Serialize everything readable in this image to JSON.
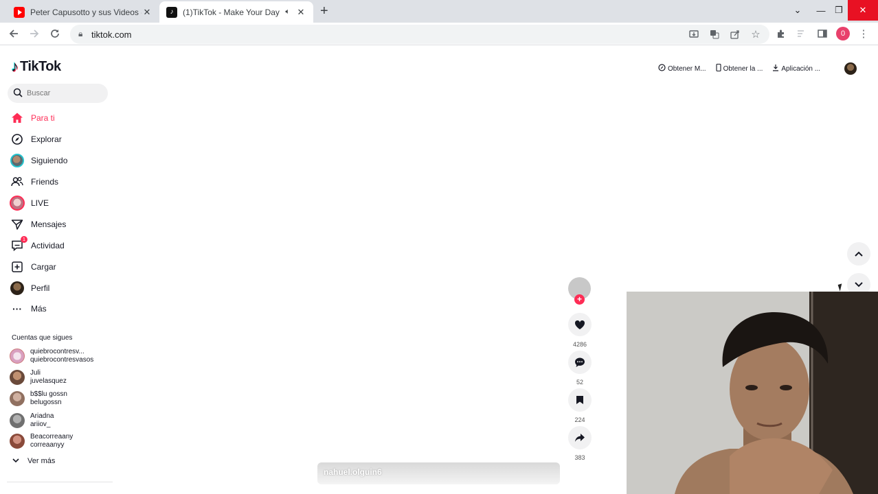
{
  "browser": {
    "tabs": [
      {
        "title": "Peter Capusotto y sus Videos - Yo",
        "active": false
      },
      {
        "title": "(1)TikTok - Make Your Day",
        "active": true
      }
    ],
    "url": "tiktok.com",
    "profile_initial": "0"
  },
  "tiktok": {
    "logo_text": "TikTok",
    "search_placeholder": "Buscar",
    "nav": [
      {
        "label": "Para ti",
        "icon": "home-icon",
        "active": true
      },
      {
        "label": "Explorar",
        "icon": "compass-icon"
      },
      {
        "label": "Siguiendo",
        "icon": "avatar"
      },
      {
        "label": "Friends",
        "icon": "friends-icon"
      },
      {
        "label": "LIVE",
        "icon": "avatar"
      },
      {
        "label": "Mensajes",
        "icon": "send-icon"
      },
      {
        "label": "Actividad",
        "icon": "inbox-icon",
        "badge": "1"
      },
      {
        "label": "Cargar",
        "icon": "upload-icon"
      },
      {
        "label": "Perfil",
        "icon": "avatar"
      },
      {
        "label": "Más",
        "icon": "more-icon"
      }
    ],
    "following_title": "Cuentas que sigues",
    "following": [
      {
        "name": "quiebrocontresv...",
        "handle": "quiebrocontresvasos",
        "color": "#d9a0c0"
      },
      {
        "name": "Juli",
        "handle": "juvelasquez",
        "color": "#7a5a4a"
      },
      {
        "name": "b$$lu gossn",
        "handle": "belugossn",
        "color": "#a08070"
      },
      {
        "name": "Ariadna",
        "handle": "ariiov_",
        "color": "#8c8c8c"
      },
      {
        "name": "Beacorreaany",
        "handle": "correaanyy",
        "color": "#9a6a5a"
      }
    ],
    "see_more": "Ver más",
    "header": {
      "items": [
        "Obtener M...",
        "Obtener la ...",
        "Aplicación ..."
      ]
    },
    "video": {
      "likes": "4286",
      "comments": "52",
      "saves": "224",
      "shares": "383",
      "caption_user": "nahuel.olguin6"
    }
  }
}
